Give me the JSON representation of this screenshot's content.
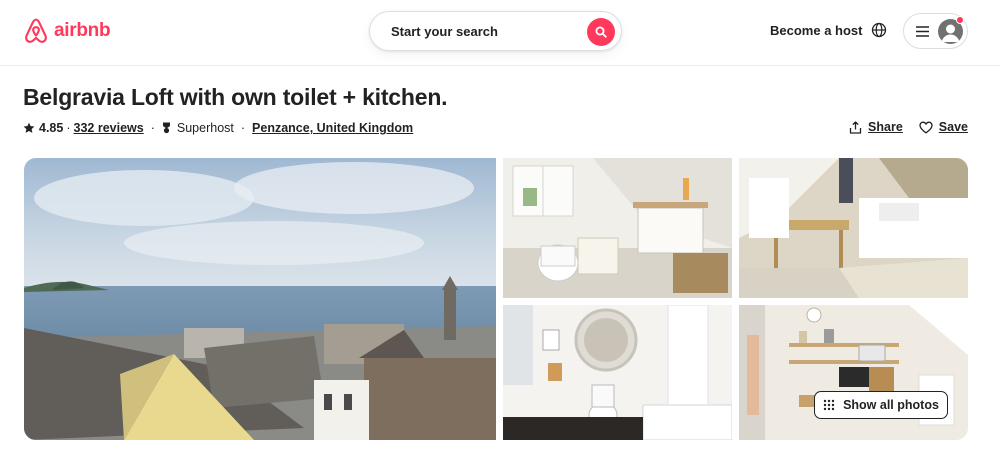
{
  "brand": {
    "name": "airbnb",
    "color": "#ff385c"
  },
  "header": {
    "search_placeholder": "Start your search",
    "host_link": "Become a host",
    "icons": [
      "search-icon",
      "globe-icon",
      "menu-icon",
      "user-avatar-icon"
    ]
  },
  "listing": {
    "title": "Belgravia Loft with own toilet + kitchen.",
    "rating": "4.85",
    "separator": "·",
    "reviews": "332 reviews",
    "superhost": "Superhost",
    "location": "Penzance, United Kingdom",
    "share_label": "Share",
    "save_label": "Save"
  },
  "gallery": {
    "photos": [
      {
        "subject": "rooftops-sea-view"
      },
      {
        "subject": "toilet-and-sink"
      },
      {
        "subject": "bedroom-with-desk"
      },
      {
        "subject": "bathroom-with-mirror"
      },
      {
        "subject": "kitchen-shelves"
      }
    ],
    "show_all_label": "Show all photos"
  }
}
